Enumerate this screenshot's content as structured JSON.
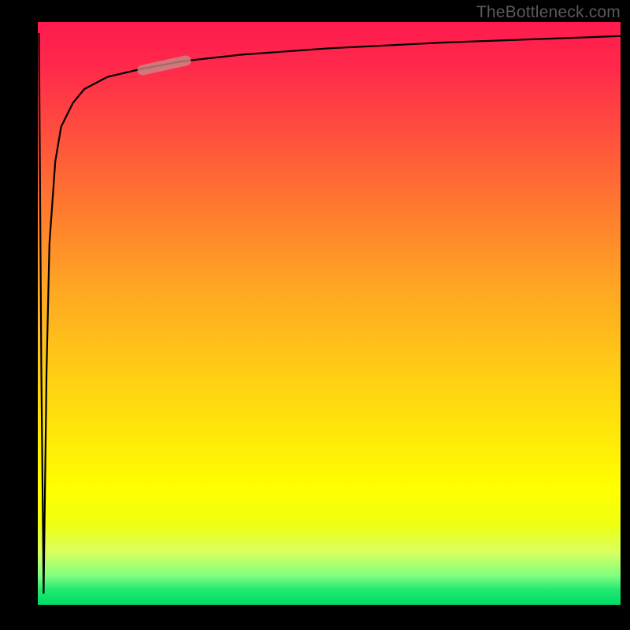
{
  "attribution": "TheBottleneck.com",
  "chart_data": {
    "type": "line",
    "title": "",
    "xlabel": "",
    "ylabel": "",
    "xlim": [
      0,
      100
    ],
    "ylim": [
      0,
      100
    ],
    "x": [
      0.2,
      0.6,
      1.0,
      1.5,
      2,
      3,
      4,
      6,
      8,
      12,
      18,
      25,
      35,
      50,
      70,
      100
    ],
    "values": [
      98,
      40,
      2,
      40,
      62,
      76,
      82,
      86,
      88.5,
      90.6,
      92,
      93.3,
      94.4,
      95.5,
      96.5,
      97.6
    ],
    "highlight_segment": {
      "x_start": 18,
      "x_end": 25,
      "y_start": 92,
      "y_end": 93.3
    },
    "background_gradient": [
      "#ff1a4f",
      "#ffa423",
      "#ffff00",
      "#00dd66"
    ]
  }
}
